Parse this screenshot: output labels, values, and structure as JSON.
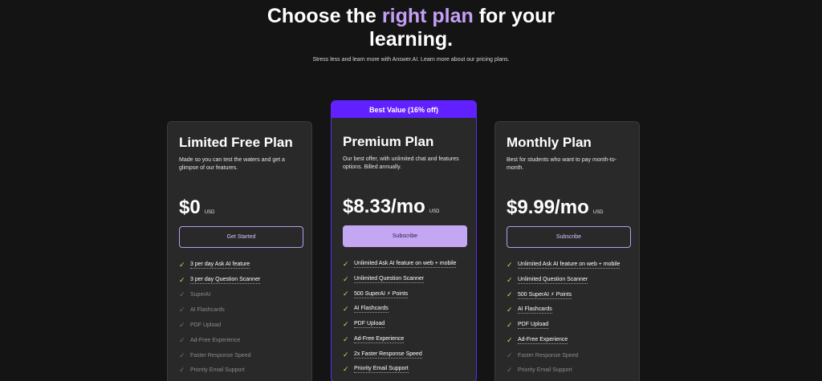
{
  "hero": {
    "title_before": "Choose the ",
    "title_accent": "right plan",
    "title_after": " for your",
    "title_line2": "learning.",
    "subtitle": "Stress less and learn more with Answer.AI. Learn more about our pricing plans."
  },
  "best_value_badge": "Best Value (16% off)",
  "plans": [
    {
      "name": "Limited Free Plan",
      "description": "Made so you can test the waters and get a glimpse of our features.",
      "price": "$0",
      "currency": "USD",
      "cta": "Get Started",
      "features": [
        {
          "text": "3 per day Ask AI feature",
          "included": true
        },
        {
          "text": "3 per day Question Scanner",
          "included": true
        },
        {
          "text": "SuperAI",
          "included": false
        },
        {
          "text": "AI Flashcards",
          "included": false
        },
        {
          "text": "PDF Upload",
          "included": false
        },
        {
          "text": "Ad-Free Experience",
          "included": false
        },
        {
          "text": "Faster Response Speed",
          "included": false
        },
        {
          "text": "Priority Email Support",
          "included": false
        }
      ]
    },
    {
      "name": "Premium Plan",
      "description": "Our best offer, with unlimited chat and features options. Billed annually.",
      "price": "$8.33/mo",
      "currency": "USD",
      "cta": "Subscribe",
      "features": [
        {
          "text": "Unlimited Ask AI feature on web + mobile",
          "included": true
        },
        {
          "text": "Unlimited Question Scanner",
          "included": true
        },
        {
          "text": "500 SuperAI ⚡ Points",
          "included": true
        },
        {
          "text": "AI Flashcards",
          "included": true
        },
        {
          "text": "PDF Upload",
          "included": true
        },
        {
          "text": "Ad-Free Experience",
          "included": true
        },
        {
          "text": "2x Faster Response Speed",
          "included": true
        },
        {
          "text": "Priority Email Support",
          "included": true
        }
      ]
    },
    {
      "name": "Monthly Plan",
      "description": "Best for students who want to pay month-to-month.",
      "price": "$9.99/mo",
      "currency": "USD",
      "cta": "Subscribe",
      "features": [
        {
          "text": "Unlimited Ask AI feature on web + mobile",
          "included": true
        },
        {
          "text": "Unlimited Question Scanner",
          "included": true
        },
        {
          "text": "500 SuperAI ⚡ Points",
          "included": true
        },
        {
          "text": "AI Flashcards",
          "included": true
        },
        {
          "text": "PDF Upload",
          "included": true
        },
        {
          "text": "Ad-Free Experience",
          "included": true
        },
        {
          "text": "Faster Response Speed",
          "included": false
        },
        {
          "text": "Priority Email Support",
          "included": false
        }
      ]
    }
  ],
  "colors": {
    "background": "#141414",
    "card": "#292929",
    "accent_purple": "#6120ff",
    "lavender": "#c4a7f3",
    "check_green": "#b7e25d"
  },
  "icons": {
    "check": "check-icon"
  }
}
